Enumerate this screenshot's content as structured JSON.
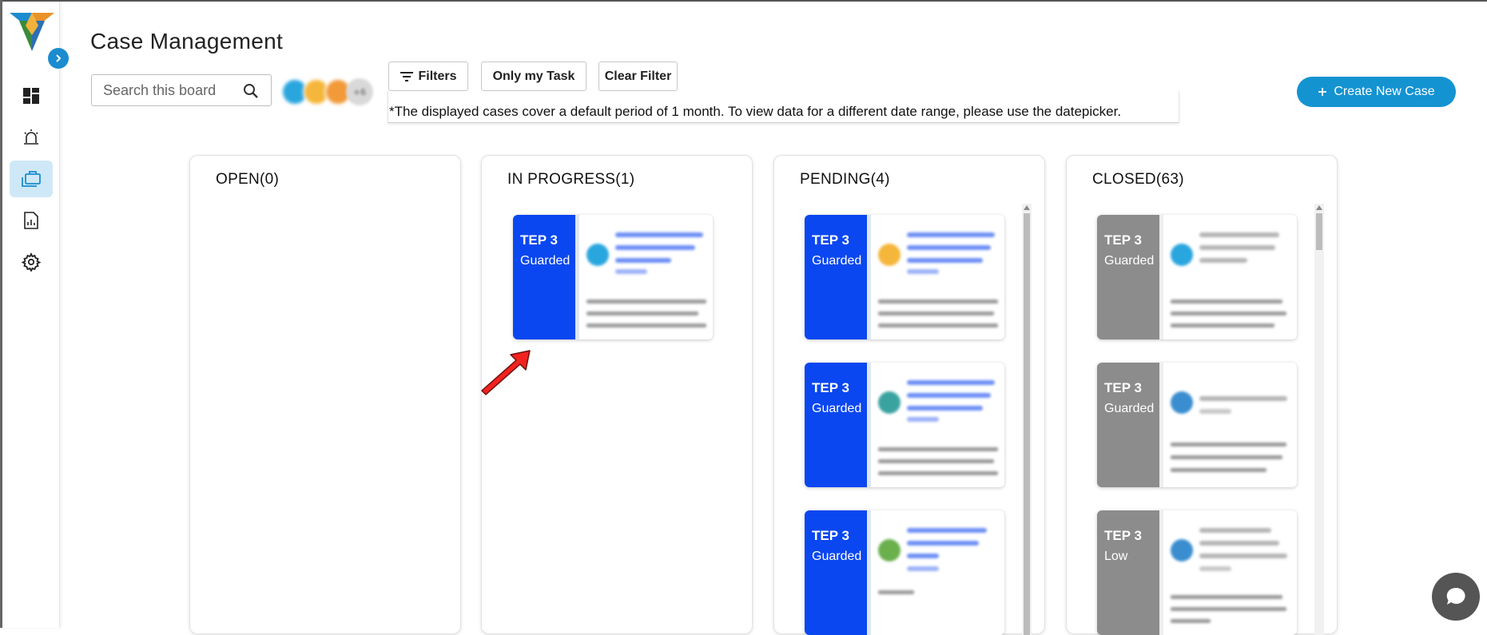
{
  "page": {
    "title": "Case Management"
  },
  "sidebar": {
    "items": [
      {
        "icon": "dashboard-icon",
        "active": false
      },
      {
        "icon": "alarm-icon",
        "active": false
      },
      {
        "icon": "briefcase-icon",
        "active": true
      },
      {
        "icon": "report-icon",
        "active": false
      },
      {
        "icon": "gear-icon",
        "active": false
      }
    ],
    "collapse_icon": "chevron-right-icon"
  },
  "search": {
    "placeholder": "Search this board",
    "value": ""
  },
  "avatars": {
    "more_label": "+6"
  },
  "toolbar": {
    "filters_label": "Filters",
    "only_my_task_label": "Only my Task",
    "clear_filter_label": "Clear Filter"
  },
  "notice": "*The displayed cases cover a default period of 1 month. To view data for a different date range, please use the datepicker.",
  "create_button": {
    "label": "Create New Case",
    "icon": "plus-icon"
  },
  "columns": [
    {
      "title": "OPEN(0)",
      "cards": []
    },
    {
      "title": "IN PROGRESS(1)",
      "cards": [
        {
          "tep": "TEP 3",
          "level": "Guarded",
          "color": "#0a47f0"
        }
      ]
    },
    {
      "title": "PENDING(4)",
      "cards": [
        {
          "tep": "TEP 3",
          "level": "Guarded",
          "color": "#0a47f0"
        },
        {
          "tep": "TEP 3",
          "level": "Guarded",
          "color": "#0a47f0"
        },
        {
          "tep": "TEP 3",
          "level": "Guarded",
          "color": "#0a47f0"
        }
      ]
    },
    {
      "title": "CLOSED(63)",
      "cards": [
        {
          "tep": "TEP 3",
          "level": "Guarded",
          "color": "#8c8c8c"
        },
        {
          "tep": "TEP 3",
          "level": "Guarded",
          "color": "#8c8c8c"
        },
        {
          "tep": "TEP 3",
          "level": "Low",
          "color": "#8c8c8c"
        }
      ]
    }
  ],
  "colors": {
    "accent": "#1493d1",
    "open_band": "#0a47f0",
    "closed_band": "#8c8c8c"
  }
}
